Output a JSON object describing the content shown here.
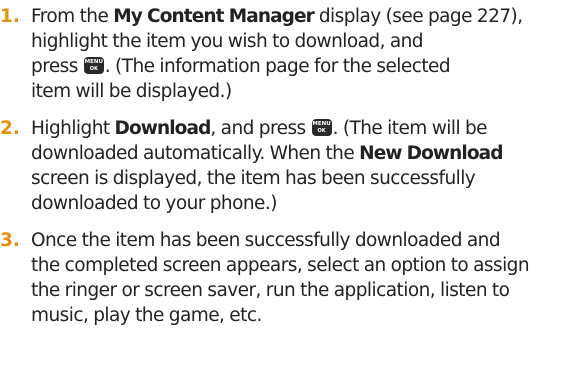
{
  "steps": [
    {
      "number": "1.",
      "lines": [
        {
          "a": "From the ",
          "b": "My Content Manager",
          "c": " display (see page 227),"
        },
        {
          "a": "highlight the item you wish to download, and"
        },
        {
          "a": "press ",
          "key": true,
          "c": ". (The information page for the selected"
        },
        {
          "a": "item will be displayed.)"
        }
      ]
    },
    {
      "number": "2.",
      "lines": [
        {
          "a": "Highlight ",
          "b": "Download",
          "c": ", and press ",
          "key": true,
          "d": ". (The item will be"
        },
        {
          "a": "downloaded automatically. When the ",
          "b": "New Download"
        },
        {
          "a": "screen is displayed, the item has been successfully"
        },
        {
          "a": "downloaded to your phone.)"
        }
      ]
    },
    {
      "number": "3.",
      "lines": [
        {
          "a": "Once the item has been successfully downloaded and"
        },
        {
          "a": "the completed screen appears, select an option to assign"
        },
        {
          "a": "the ringer or screen saver, run the application, listen to"
        },
        {
          "a": "music, play the game, etc."
        }
      ]
    }
  ],
  "menu_key": {
    "line1": "MENU",
    "line2": "OK",
    "icon": "menu-ok-key-icon"
  },
  "colors": {
    "number": "#e8900a",
    "text": "#222222",
    "key_bg": "#2a2a2a"
  }
}
